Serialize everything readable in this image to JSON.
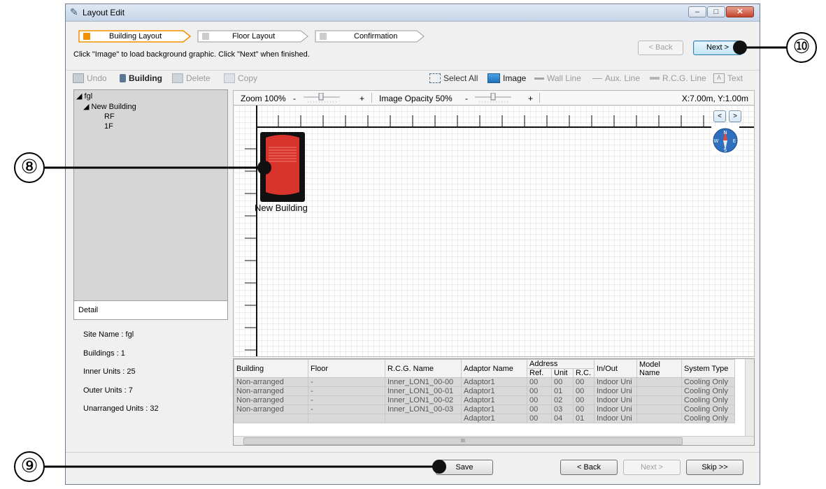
{
  "window": {
    "title": "Layout Edit"
  },
  "wizard": {
    "steps": [
      {
        "label": "Building Layout",
        "active": true
      },
      {
        "label": "Floor Layout",
        "active": false
      },
      {
        "label": "Confirmation",
        "active": false
      }
    ]
  },
  "hint": "Click \"Image\" to load background graphic. Click \"Next\" when finished.",
  "top_buttons": {
    "back": "< Back",
    "next": "Next >"
  },
  "toolbar": {
    "undo": "Undo",
    "building": "Building",
    "delete": "Delete",
    "copy": "Copy",
    "select_all": "Select All",
    "image": "Image",
    "wall_line": "Wall Line",
    "aux_line": "Aux. Line",
    "rcg_line": "R.C.G. Line",
    "text": "Text"
  },
  "tree": {
    "root": "fgl",
    "building": "New Building",
    "floors": [
      "RF",
      "1F"
    ]
  },
  "detail": {
    "header": "Detail",
    "site_name": "Site Name : fgl",
    "buildings": "Buildings : 1",
    "inner_units": "Inner Units : 25",
    "outer_units": "Outer Units : 7",
    "unarranged_units": "Unarranged Units : 32"
  },
  "zoombar": {
    "zoom_label": "Zoom 100%",
    "minus": "-",
    "plus": "+",
    "opacity_label": "Image Opacity 50%",
    "coords": "X:7.00m, Y:1.00m"
  },
  "canvas": {
    "building_label": "New Building",
    "nav_prev": "<",
    "nav_next": ">",
    "compass": {
      "n": "N",
      "s": "S",
      "e": "E",
      "w": "W"
    }
  },
  "table": {
    "headers": {
      "building": "Building",
      "floor": "Floor",
      "rcg_name": "R.C.G. Name",
      "adaptor_name": "Adaptor Name",
      "address": "Address",
      "ref": "Ref.",
      "unit": "Unit",
      "rc": "R.C.",
      "in_out": "In/Out",
      "model_name": "Model Name",
      "system_type": "System Type"
    },
    "rows": [
      {
        "building": "Non-arranged",
        "floor": "-",
        "rcg": "Inner_LON1_00-00",
        "adaptor": "Adaptor1",
        "ref": "00",
        "unit": "00",
        "rc": "00",
        "inout": "Indoor Uni",
        "model": "",
        "system": "Cooling Only"
      },
      {
        "building": "Non-arranged",
        "floor": "-",
        "rcg": "Inner_LON1_00-01",
        "adaptor": "Adaptor1",
        "ref": "00",
        "unit": "01",
        "rc": "00",
        "inout": "Indoor Uni",
        "model": "",
        "system": "Cooling Only"
      },
      {
        "building": "Non-arranged",
        "floor": "-",
        "rcg": "Inner_LON1_00-02",
        "adaptor": "Adaptor1",
        "ref": "00",
        "unit": "02",
        "rc": "00",
        "inout": "Indoor Uni",
        "model": "",
        "system": "Cooling Only"
      },
      {
        "building": "Non-arranged",
        "floor": "-",
        "rcg": "Inner_LON1_00-03",
        "adaptor": "Adaptor1",
        "ref": "00",
        "unit": "03",
        "rc": "00",
        "inout": "Indoor Uni",
        "model": "",
        "system": "Cooling Only"
      },
      {
        "building": "",
        "floor": "",
        "rcg": "",
        "adaptor": "Adaptor1",
        "ref": "00",
        "unit": "04",
        "rc": "01",
        "inout": "Indoor Uni",
        "model": "",
        "system": "Cooling Only"
      }
    ],
    "hscroll_mark": "III"
  },
  "footer": {
    "save": "Save",
    "back": "< Back",
    "next": "Next >",
    "skip": "Skip >>"
  },
  "callouts": {
    "c8": "⑧",
    "c9": "⑨",
    "c10": "⑩"
  },
  "colors": {
    "active_step": "#f29100",
    "building_icon": "#d9342b",
    "title_gradient": "#c6d5e8"
  }
}
